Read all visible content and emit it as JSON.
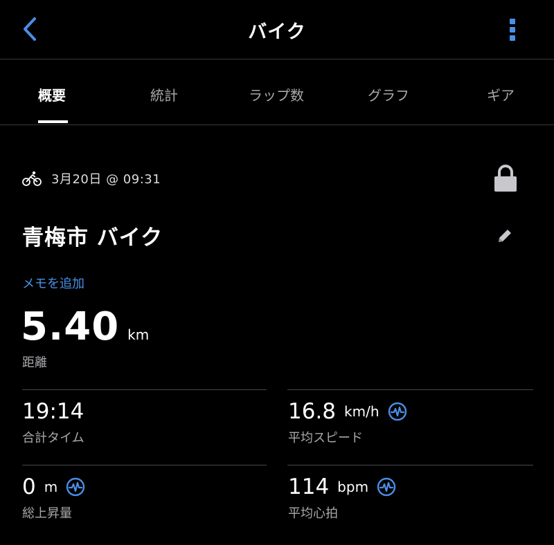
{
  "header": {
    "title": "バイク",
    "back_icon": "chevron-left-icon",
    "more_icon": "more-vertical-icon",
    "accent": "#4a8fe7"
  },
  "tabs": [
    {
      "label": "概要",
      "active": true
    },
    {
      "label": "統計"
    },
    {
      "label": "ラップ数"
    },
    {
      "label": "グラフ"
    },
    {
      "label": "ギア"
    }
  ],
  "activity": {
    "icon": "bike-icon",
    "date_time": "3月20日 @ 09:31",
    "lock_icon": "lock-icon",
    "title": "青梅市 バイク",
    "edit_icon": "pencil-icon",
    "add_memo": "メモを追加"
  },
  "distance": {
    "value": "5.40",
    "unit": "km",
    "label": "距離"
  },
  "stats": {
    "total_time": {
      "value": "19:14",
      "unit": "",
      "label": "合計タイム"
    },
    "avg_speed": {
      "value": "16.8",
      "unit": "km/h",
      "label": "平均スピード",
      "icon": "heart-rate-icon"
    },
    "elev_gain": {
      "value": "0",
      "unit": "m",
      "label": "総上昇量",
      "icon": "heart-rate-icon"
    },
    "avg_hr": {
      "value": "114",
      "unit": "bpm",
      "label": "平均心拍",
      "icon": "heart-rate-icon"
    }
  }
}
